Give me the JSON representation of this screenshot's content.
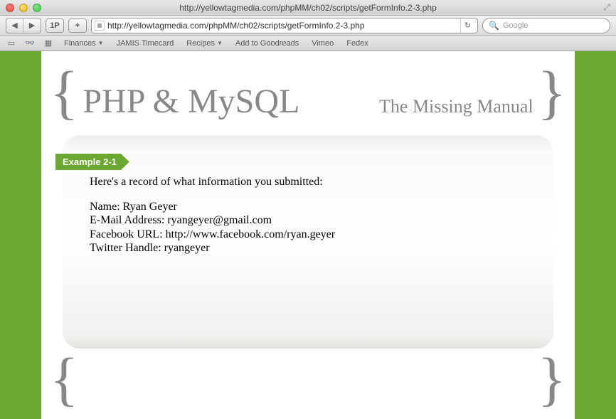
{
  "window": {
    "title": "http://yellowtagmedia.com/phpMM/ch02/scripts/getFormInfo.2-3.php"
  },
  "toolbar": {
    "onep_label": "1P",
    "plus_label": "+",
    "url": "http://yellowtagmedia.com/phpMM/ch02/scripts/getFormInfo.2-3.php",
    "search_placeholder": "Google"
  },
  "bookmarks": {
    "items": [
      {
        "label": "Finances",
        "has_menu": true
      },
      {
        "label": "JAMIS Timecard",
        "has_menu": false
      },
      {
        "label": "Recipes",
        "has_menu": true
      },
      {
        "label": "Add to Goodreads",
        "has_menu": false
      },
      {
        "label": "Vimeo",
        "has_menu": false
      },
      {
        "label": "Fedex",
        "has_menu": false
      }
    ]
  },
  "page": {
    "brace_left": "{",
    "brace_right": "}",
    "main_title": "PHP & MySQL",
    "subtitle": "The Missing Manual",
    "example_label": "Example 2-1",
    "intro": "Here's a record of what information you submitted:",
    "records": {
      "name_label": "Name:",
      "name_value": "Ryan Geyer",
      "email_label": "E-Mail Address:",
      "email_value": "ryangeyer@gmail.com",
      "fb_label": "Facebook URL:",
      "fb_value": "http://www.facebook.com/ryan.geyer",
      "tw_label": "Twitter Handle:",
      "tw_value": "ryangeyer"
    }
  }
}
